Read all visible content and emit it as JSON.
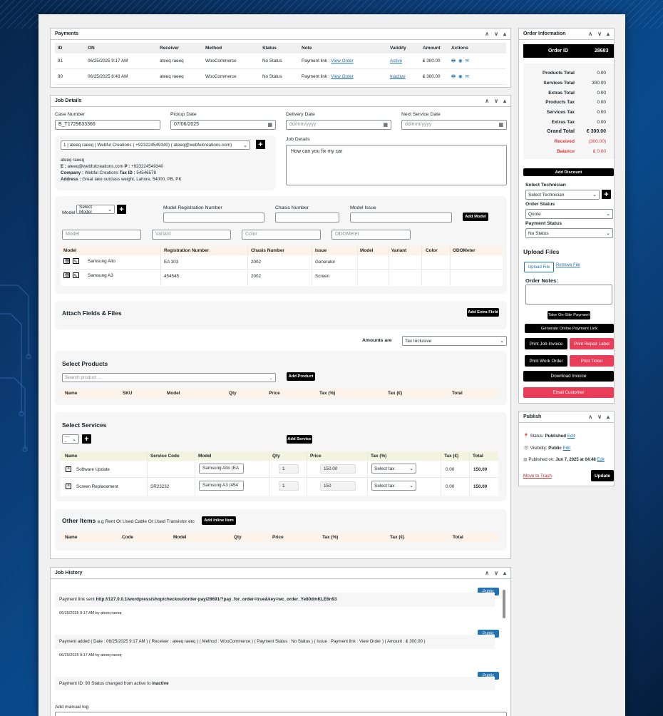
{
  "payments": {
    "title": "Payments",
    "headers": [
      "ID",
      "ON",
      "Receiver",
      "Method",
      "Status",
      "Note",
      "Validity",
      "Amount",
      "Actions"
    ],
    "rows": [
      {
        "id": "91",
        "on": "06/25/2025 9:17 AM",
        "receiver": "ateeq raeeq",
        "method": "WooCommerce",
        "status": "No Status",
        "note": "Payment link : ",
        "note_link": "View Order",
        "validity": "Active",
        "amount": "₤ 300.00"
      },
      {
        "id": "90",
        "on": "06/25/2025 8:43 AM",
        "receiver": "ateeq raeeq",
        "method": "WooCommerce",
        "status": "No Status",
        "note": "Payment link : ",
        "note_link": "View Order",
        "validity": "Inactive",
        "amount": "₤ 300.00"
      }
    ]
  },
  "job": {
    "title": "Job Details",
    "case_label": "Case Number",
    "case_value": "B_T1729633366",
    "pickup_label": "Pickup Date",
    "pickup_value": "07/06/2025",
    "delivery_label": "Delivery Date",
    "delivery_ph": "dd/mm/yyyy",
    "next_label": "Next Service Date",
    "next_ph": "dd/mm/yyyy",
    "customer_select": "1 | ateeq raeeq | Webful Creations ( +923224549340) ( ateeq@webfulcreations.com)",
    "cust_name": "ateeq raeeq",
    "cust_email_k": "E : ",
    "cust_email": "ateeq@webfulcreations.com",
    "cust_phone_k": " P : ",
    "cust_phone": "+923224549340",
    "cust_company_k": "Company : ",
    "cust_company": "Webful Creations",
    "cust_tax_k": " Tax ID : ",
    "cust_tax": "54546578",
    "cust_addr_k": "Address : ",
    "cust_addr": "Great lake outclass weight, Lahore, 54000, PB, PK",
    "details_label": "Job Details",
    "details_value": "How can you fix my car"
  },
  "models": {
    "model_label": "Model",
    "model_select": "Select Model",
    "reg_label": "Model Registration Number",
    "chasis_label": "Chasis Number",
    "issue_label": "Model Issue",
    "add_model": "Add Model",
    "ph_model": "Model",
    "ph_variant": "Variant",
    "ph_color": "Color",
    "ph_odo": "ODOMeter",
    "headers": [
      "Model",
      "Registration Number",
      "Chasis Number",
      "Issue",
      "Model",
      "Variant",
      "Color",
      "ODOMeter"
    ],
    "rows": [
      {
        "model": "Samsung Alto",
        "reg": "EA 303",
        "chasis": "2002",
        "issue": "Generator"
      },
      {
        "model": "Samsung A3",
        "reg": "454545",
        "chasis": "2002",
        "issue": "Screen"
      }
    ]
  },
  "attach": {
    "title": "Attach Fields & Files",
    "button": "Add Extra Field"
  },
  "amounts": {
    "label": "Amounts are",
    "value": "Tax Inclusive"
  },
  "products": {
    "title": "Select Products",
    "search_ph": "Search product ...",
    "add": "Add Product",
    "headers": [
      "Name",
      "SKU",
      "Model",
      "Qty",
      "Price",
      "Tax (%)",
      "Tax (€)",
      "Total"
    ]
  },
  "services": {
    "title": "Select Services",
    "select": "----",
    "add": "Add Service",
    "headers": [
      "Name",
      "Service Code",
      "Model",
      "Qty",
      "Price",
      "Tax (%)",
      "Tax (€)",
      "Total"
    ],
    "rows": [
      {
        "name": "Software Update",
        "code": "",
        "model": "Samsung Alto (EA",
        "qty": "1",
        "price": "150.00",
        "tax": "Select tax",
        "taxe": "0.00",
        "total": "150.00"
      },
      {
        "name": "Screen Replacement",
        "code": "SR23232",
        "model": "Samsung A3 (454",
        "qty": "1",
        "price": "150",
        "tax": "Select tax",
        "taxe": "0.00",
        "total": "150.00"
      }
    ]
  },
  "other": {
    "title": "Other Items",
    "subtitle": "e.g Rent Or Used Cable Or Used Transistor etc",
    "add": "Add Inline Item",
    "headers": [
      "Name",
      "Code",
      "Model",
      "Qty",
      "Price",
      "Tax (%)",
      "Tax (€)",
      "Total"
    ]
  },
  "history": {
    "title": "Job History",
    "public": "Public",
    "logs": [
      {
        "text": "Payment link sent ",
        "bold": "http://127.0.0.1/wordpress/shop/checkout/order-pay/28691/?pay_for_order=true&key=wc_order_Ye80dmKLE6n93",
        "meta": "06/25/2025 9:17 AM by ateeq raeeq"
      },
      {
        "text": "Payment added ( Date : 06/25/2025 9:17 AM ) ( Receiver : ateeq raeeq ) ( Method : WooCommerce ) ( Payment Status : No Status ) ( Issue : Payment link : View Order ) ( Amount : ₤ 300.00 )",
        "meta": "06/25/2025 9:17 AM by ateeq raeeq"
      },
      {
        "text": "Payment ID: 90 Status changed from active to ",
        "bold": "inactive"
      }
    ],
    "manual_label": "Add manual log"
  },
  "order": {
    "title": "Order Information",
    "id_label": "Order ID",
    "id_value": "28683",
    "rows": [
      {
        "k": "Products Total",
        "v": "0.00"
      },
      {
        "k": "Services Total",
        "v": "300.00"
      },
      {
        "k": "Extras Total",
        "v": "0.00"
      },
      {
        "k": "Products Tax",
        "v": "0.00"
      },
      {
        "k": "Services Tax",
        "v": "0.00"
      },
      {
        "k": "Extras Tax",
        "v": "0.00"
      },
      {
        "k": "Grand Total",
        "v": "€ 300.00"
      },
      {
        "k": "Received",
        "v": "(300.00)"
      },
      {
        "k": "Balance",
        "v": "₤ 0.00"
      }
    ],
    "add_discount": "Add Discount",
    "tech_label": "Select Technician",
    "tech_select": "Select Technician",
    "status_label": "Order Status",
    "status_value": "Quote",
    "pay_label": "Payment Status",
    "pay_value": "No Status",
    "upload_title": "Upload Files",
    "upload_btn": "Upload File",
    "remove_file": "Remove File",
    "notes_label": "Order Notes:",
    "onsite": "Take On-Site Payment",
    "gen_link": "Generate Online Payment Link",
    "print_job": "Print Job Invoice",
    "print_repair": "Print Repair Label",
    "print_work": "Print Work Order",
    "print_ticket": "Print Ticket",
    "download": "Download Invoice",
    "email": "Email Customer"
  },
  "publish": {
    "title": "Publish",
    "status_k": "Status: ",
    "status_v": "Published",
    "edit": "Edit",
    "vis_k": "Visibility: ",
    "vis_v": "Public",
    "pub_k": "Published on: ",
    "pub_v": "Jun 7, 2025 at 04:48",
    "trash": "Move to Trash",
    "update": "Update"
  },
  "colors": {
    "accent": "#2271b1",
    "danger": "#e83e5a",
    "th_peach": "#fdf3e8",
    "th_lime": "#f3f4df"
  }
}
